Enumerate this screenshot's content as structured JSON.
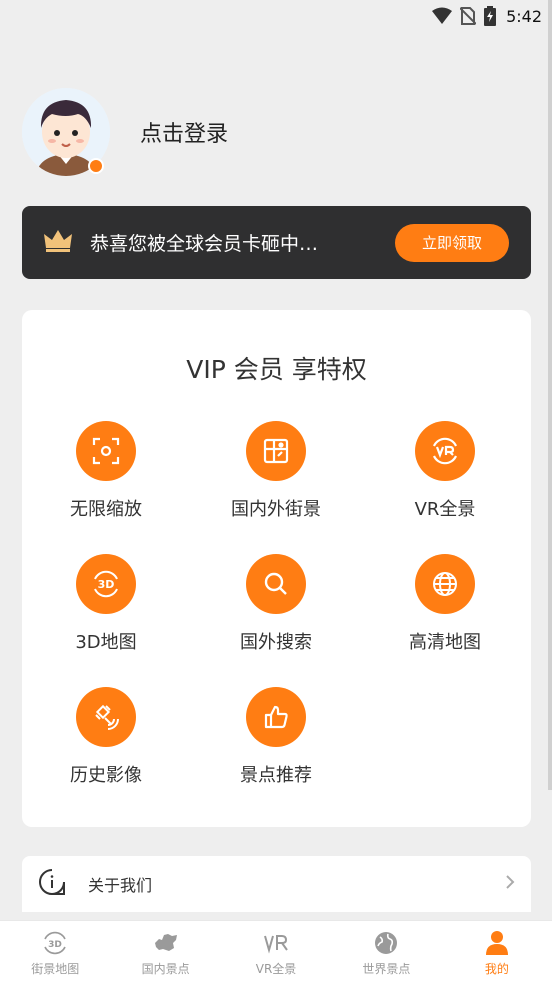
{
  "status_bar": {
    "time": "5:42"
  },
  "profile": {
    "login_label": "点击登录"
  },
  "banner": {
    "text": "恭喜您被全球会员卡砸中…",
    "button_label": "立即领取"
  },
  "vip": {
    "title": "VIP 会员 享特权",
    "features": [
      {
        "label": "无限缩放",
        "icon": "zoom-icon"
      },
      {
        "label": "国内外街景",
        "icon": "street-view-icon"
      },
      {
        "label": "VR全景",
        "icon": "vr-icon"
      },
      {
        "label": "3D地图",
        "icon": "3d-map-icon"
      },
      {
        "label": "国外搜索",
        "icon": "search-icon"
      },
      {
        "label": "高清地图",
        "icon": "globe-icon"
      },
      {
        "label": "历史影像",
        "icon": "satellite-icon"
      },
      {
        "label": "景点推荐",
        "icon": "thumbs-up-icon"
      }
    ]
  },
  "about": {
    "label": "关于我们"
  },
  "bottom_nav": {
    "items": [
      {
        "label": "街景地图",
        "icon": "3d-icon"
      },
      {
        "label": "国内景点",
        "icon": "china-map-icon"
      },
      {
        "label": "VR全景",
        "icon": "vr-icon"
      },
      {
        "label": "世界景点",
        "icon": "globe-icon"
      },
      {
        "label": "我的",
        "icon": "person-icon",
        "active": true
      }
    ]
  },
  "colors": {
    "accent": "#ff7d13",
    "banner_bg": "#2f2f30",
    "page_bg": "#eeeeee"
  }
}
